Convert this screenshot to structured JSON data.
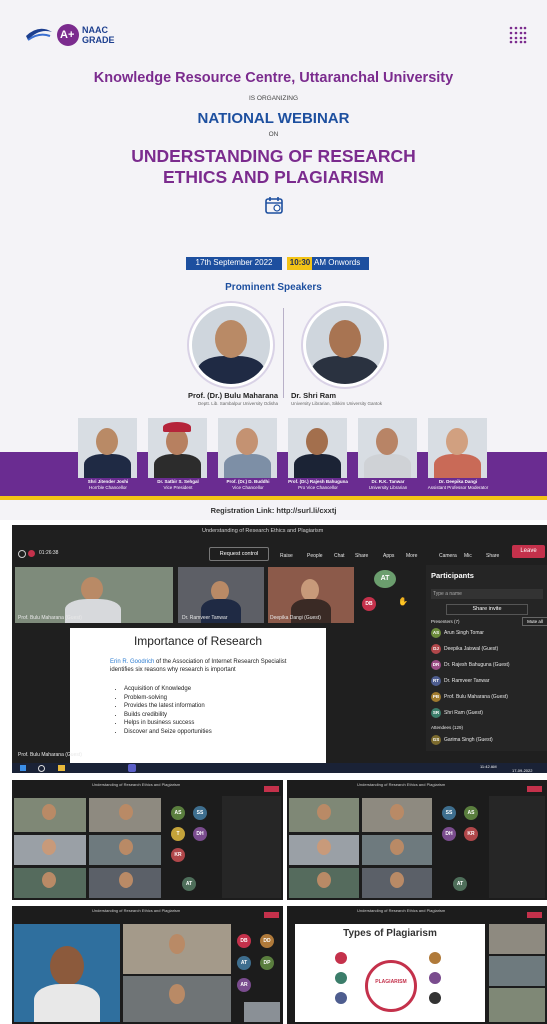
{
  "poster": {
    "naac_top": "NAAC",
    "naac_bottom": "GRADE",
    "grade_badge": "A+",
    "organizer": "Knowledge Resource Centre, Uttaranchal University",
    "is_organizing": "IS ORGANIZING",
    "event_type": "NATIONAL WEBINAR",
    "on": "ON",
    "title_line1": "UNDERSTANDING OF RESEARCH",
    "title_line2": "ETHICS AND PLAGIARISM",
    "date": "17th September 2022",
    "time": "10:30",
    "time_suffix": "AM Onwords",
    "speakers_heading": "Prominent Speakers",
    "speakers": [
      {
        "name": "Prof. (Dr.) Bulu Maharana",
        "role": "Deptt. Lib. Sambalpur University Odisha"
      },
      {
        "name": "Dr. Shri Ram",
        "role": "University Librarian, Sikkim University Gantok"
      }
    ],
    "panel": [
      {
        "name": "Shri Jitender Joshi",
        "role": "Hon'ble Chancellor"
      },
      {
        "name": "Dr. Satbir S. Sehgal",
        "role": "Vice President"
      },
      {
        "name": "Prof. (Dr.) D. Buddhi",
        "role": "Vice Chancellor"
      },
      {
        "name": "Prof. (Dr.) Rajesh Bahuguna",
        "role": "Pro Vice Chancellor"
      },
      {
        "name": "Dr. R.K. Tanwar",
        "role": "University Librarian"
      },
      {
        "name": "Dr. Deepika Dangi",
        "role": "Assistant Professor Moderator"
      }
    ],
    "registration": "Registration Link: http://surl.li/cxxtj"
  },
  "meeting_main": {
    "window_title": "Understanding of Research Ethics and Plagiarism",
    "timer": "01:26:38",
    "request_control": "Request control",
    "toolbar": [
      "Raise",
      "People",
      "Chat",
      "Share",
      "Apps",
      "More",
      "Camera",
      "Mic",
      "Share"
    ],
    "leave": "Leave",
    "tiles": [
      "Prof. Bulu Maharana (Guest)",
      "Dr. Ramveer Tanwar",
      "Deepika Dangi (Guest)"
    ],
    "avatars": [
      "AT",
      "DB"
    ],
    "slide": {
      "heading": "Importance of Research",
      "author": "Erin R. Goodrich",
      "intro": "of the Association of Internet Research Specialist identifies six reasons why research is important",
      "bullets": [
        "Acquisition of Knowledge",
        "Problem-solving",
        "Provides the latest information",
        "Builds credibility",
        "Helps in business success",
        "Discover and Seize opportunities"
      ]
    },
    "presenter_label": "Prof. Bulu Maharana (Guest)",
    "participants": {
      "title": "Participants",
      "search": "Type a name",
      "share_invite": "Share invite",
      "mute_all": "Mute all",
      "in_meeting": "Presenters (7)",
      "people": [
        {
          "initials": "AS",
          "name": "Arun Singh Tomar",
          "color": "#6b8a3a"
        },
        {
          "initials": "DJ",
          "name": "Deepika Jaiswal (Guest)",
          "color": "#b0474a"
        },
        {
          "initials": "DR",
          "name": "Dr. Rajesh Bahuguna (Guest)",
          "color": "#9b4c86"
        },
        {
          "initials": "RT",
          "name": "Dr. Ramveer Tanwar",
          "color": "#4e5d8f"
        },
        {
          "initials": "PB",
          "name": "Prof. Bulu Maharana (Guest)",
          "color": "#a07a2e"
        },
        {
          "initials": "SR",
          "name": "Shri Ram (Guest)",
          "color": "#3b7d6a"
        }
      ],
      "attendees_label": "Attendees (129)",
      "attendee": {
        "initials": "GS",
        "name": "Garima Singh (Guest)",
        "color": "#7c6b2e"
      }
    },
    "taskbar_time": "11:42 AM",
    "taskbar_date": "17-09-2022"
  },
  "gallery_left": {
    "title": "Understanding of Research Ethics and Plagiarism",
    "avatars": [
      "AS",
      "SS",
      "T",
      "DH",
      "KR",
      "AT"
    ]
  },
  "gallery_right": {
    "title": "Understanding of Research Ethics and Plagiarism",
    "avatars": [
      "SS",
      "AS",
      "DH",
      "KR",
      "AT"
    ]
  },
  "bottom_left": {
    "title": "Understanding of Research Ethics and Plagiarism",
    "avatars": [
      "DB",
      "DD",
      "AT",
      "DP",
      "AR"
    ]
  },
  "bottom_right": {
    "title": "Understanding of Research Ethics and Plagiarism",
    "slide_heading": "Types of Plagiarism",
    "center_label": "PLAGIARISM"
  },
  "colors": {
    "purple": "#6a2c91",
    "yellow": "#f3c316",
    "teams_bg": "#1f1f1f",
    "leave_red": "#c4314b"
  }
}
